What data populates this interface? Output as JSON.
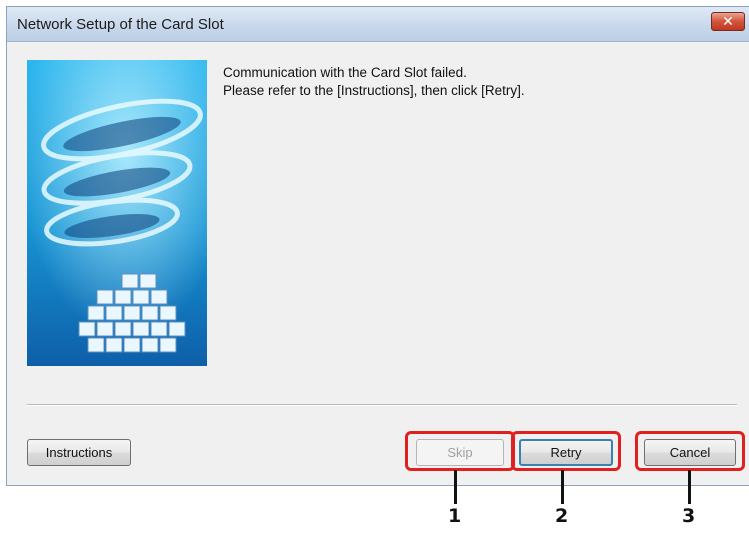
{
  "window": {
    "title": "Network Setup of the Card Slot",
    "close_glyph": "✕"
  },
  "message": {
    "line1": "Communication with the Card Slot failed.",
    "line2": "Please refer to the [Instructions], then click [Retry]."
  },
  "buttons": {
    "instructions": "Instructions",
    "skip": "Skip",
    "retry": "Retry",
    "cancel": "Cancel"
  },
  "callouts": {
    "skip": "1",
    "retry": "2",
    "cancel": "3"
  },
  "colors": {
    "highlight": "#e01f1f",
    "banner_blue": "#1aa7e0"
  }
}
